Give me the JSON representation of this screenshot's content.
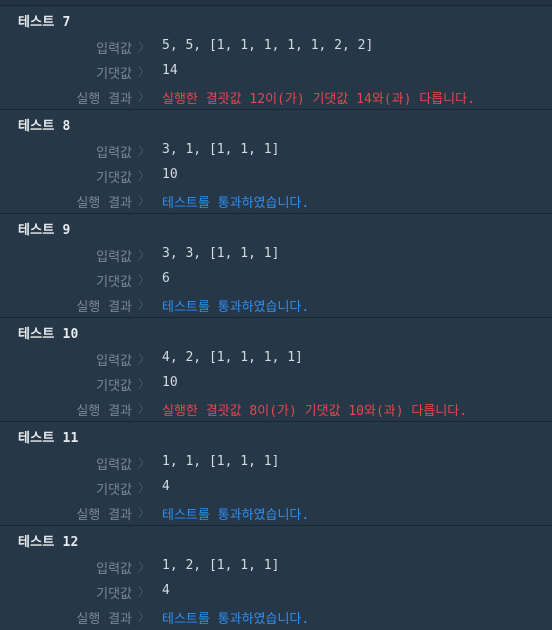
{
  "labels": {
    "input": "입력값",
    "expected": "기댓값",
    "result": "실행 결과",
    "separator": "〉"
  },
  "tests": [
    {
      "title": "테스트 7",
      "input": "5, 5, [1, 1, 1, 1, 1, 2, 2]",
      "expected": "14",
      "result": "실행한 결괏값 12이(가) 기댓값 14와(과) 다릅니다.",
      "status": "fail"
    },
    {
      "title": "테스트 8",
      "input": "3, 1, [1, 1, 1]",
      "expected": "10",
      "result": "테스트를 통과하였습니다.",
      "status": "pass"
    },
    {
      "title": "테스트 9",
      "input": "3, 3, [1, 1, 1]",
      "expected": "6",
      "result": "테스트를 통과하였습니다.",
      "status": "pass"
    },
    {
      "title": "테스트 10",
      "input": "4, 2, [1, 1, 1, 1]",
      "expected": "10",
      "result": "실행한 결괏값 8이(가) 기댓값 10와(과) 다릅니다.",
      "status": "fail"
    },
    {
      "title": "테스트 11",
      "input": "1, 1, [1, 1, 1]",
      "expected": "4",
      "result": "테스트를 통과하였습니다.",
      "status": "pass"
    },
    {
      "title": "테스트 12",
      "input": "1, 2, [1, 1, 1]",
      "expected": "4",
      "result": "테스트를 통과하였습니다.",
      "status": "pass"
    }
  ],
  "colors": {
    "background": "#263747",
    "fail": "#e5484d",
    "pass": "#2f8ff5",
    "label": "#7b8794"
  }
}
